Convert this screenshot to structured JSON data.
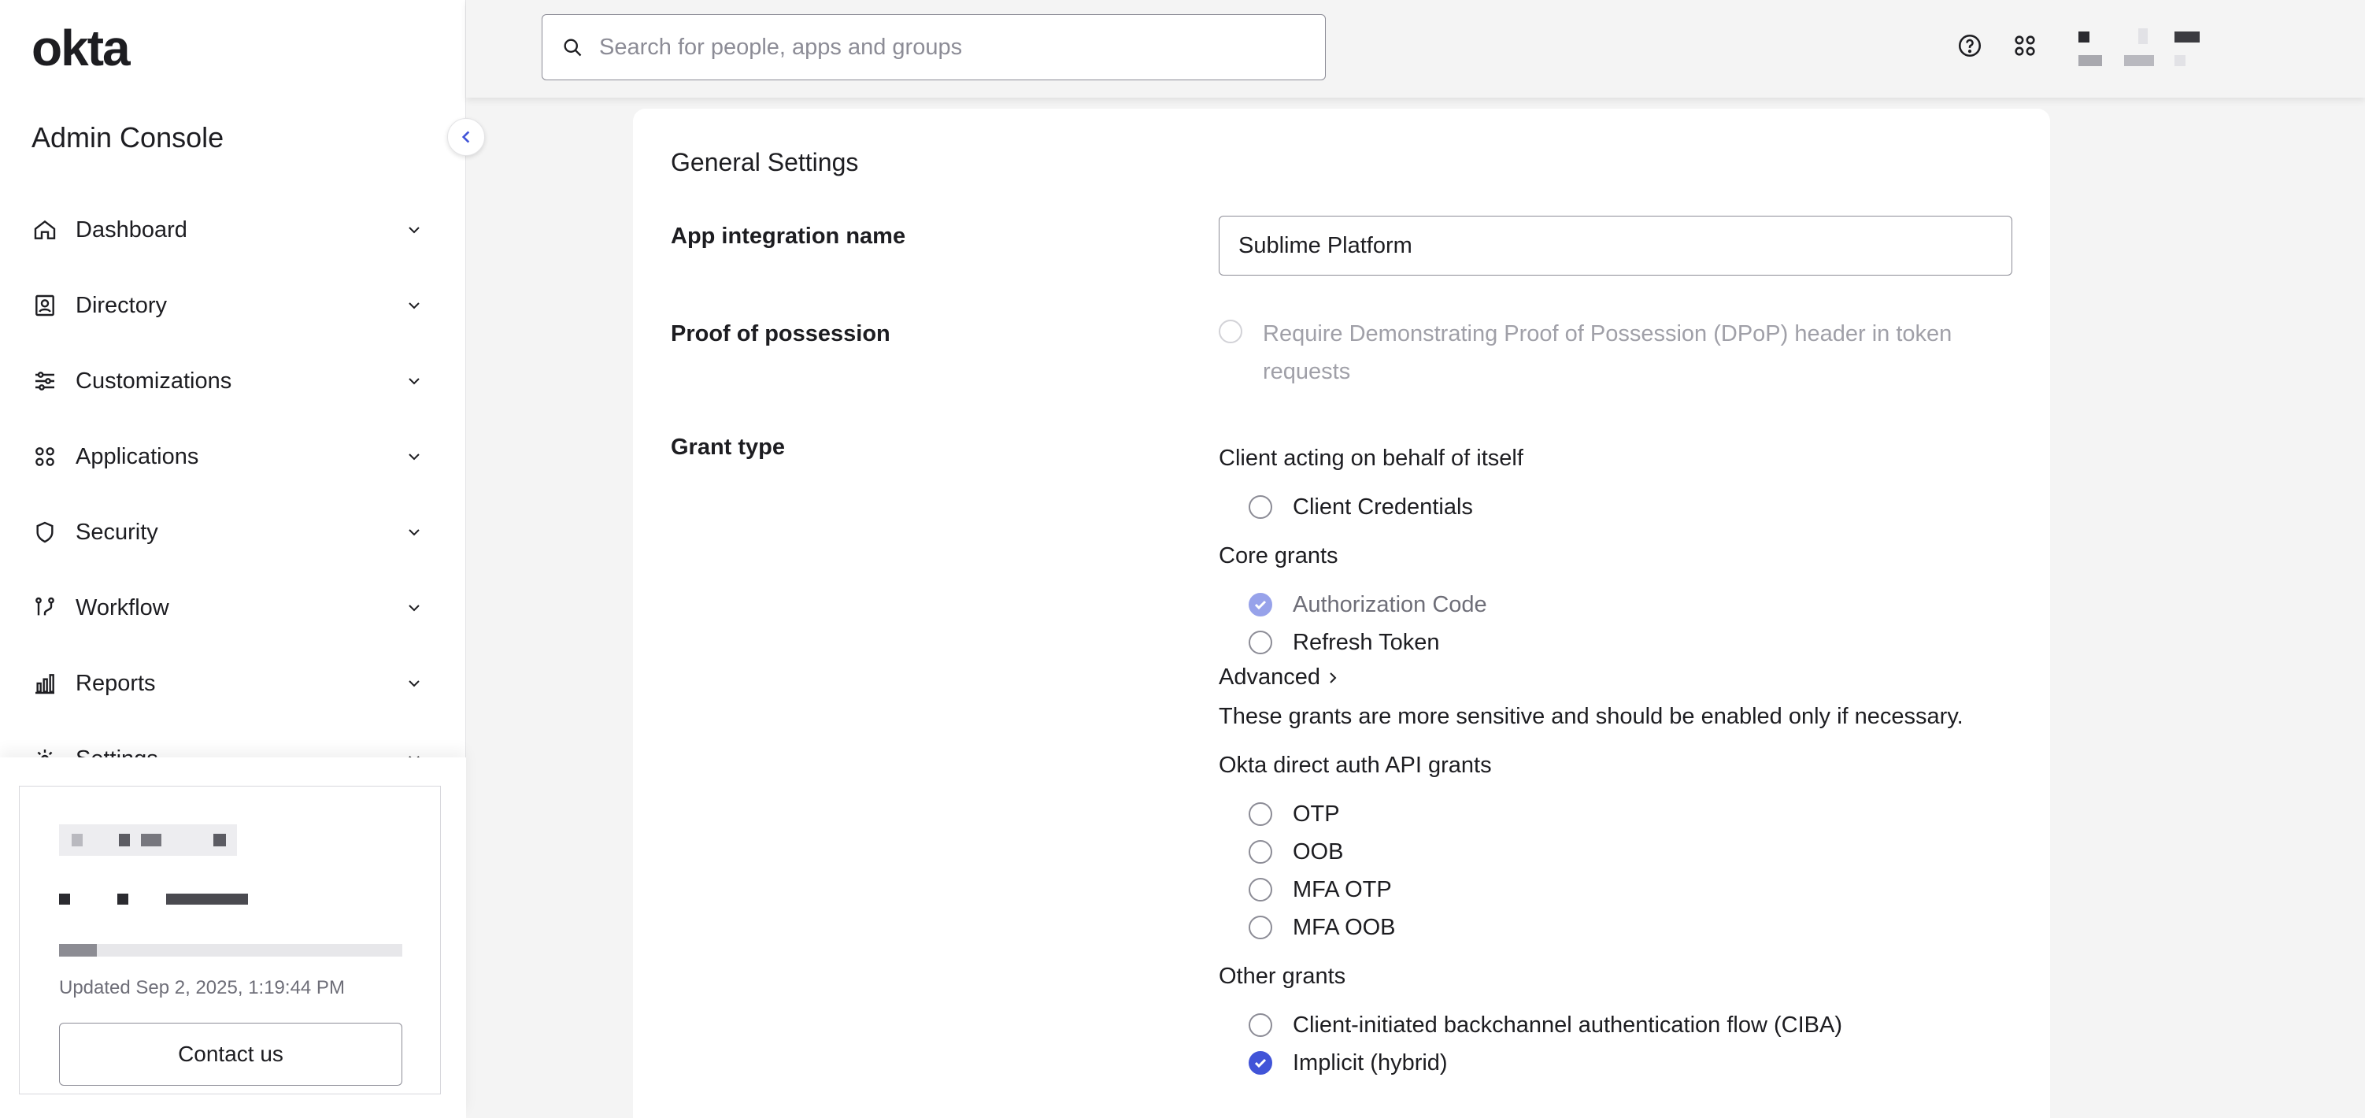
{
  "app": {
    "logo": "okta",
    "console_title": "Admin Console"
  },
  "search": {
    "placeholder": "Search for people, apps and groups",
    "value": ""
  },
  "sidebar": {
    "items": [
      {
        "label": "Dashboard",
        "icon": "home-icon"
      },
      {
        "label": "Directory",
        "icon": "directory-icon"
      },
      {
        "label": "Customizations",
        "icon": "sliders-icon"
      },
      {
        "label": "Applications",
        "icon": "apps-grid-icon"
      },
      {
        "label": "Security",
        "icon": "shield-icon"
      },
      {
        "label": "Workflow",
        "icon": "workflow-icon"
      },
      {
        "label": "Reports",
        "icon": "bar-chart-icon"
      },
      {
        "label": "Settings",
        "icon": "gear-icon"
      }
    ]
  },
  "status_card": {
    "updated": "Updated Sep 2, 2025, 1:19:44 PM",
    "contact_label": "Contact us",
    "progress": 0.11
  },
  "general": {
    "title": "General Settings",
    "app_name_label": "App integration name",
    "app_name_value": "Sublime Platform",
    "pop_label": "Proof of possession",
    "pop_text": "Require Demonstrating Proof of Possession (DPoP) header in token requests",
    "grant_label": "Grant type",
    "client_group": "Client acting on behalf of itself",
    "client_credentials": "Client Credentials",
    "core_group": "Core grants",
    "authorization_code": "Authorization Code",
    "refresh_token": "Refresh Token",
    "advanced": "Advanced",
    "advanced_note": "These grants are more sensitive and should be enabled only if necessary.",
    "direct_group": "Okta direct auth API grants",
    "otp": "OTP",
    "oob": "OOB",
    "mfa_otp": "MFA OTP",
    "mfa_oob": "MFA OOB",
    "other_group": "Other grants",
    "ciba": "Client-initiated backchannel authentication flow (CIBA)",
    "implicit": "Implicit (hybrid)"
  },
  "colors": {
    "accent": "#4154d8",
    "accent_disabled": "#97a2ea"
  }
}
